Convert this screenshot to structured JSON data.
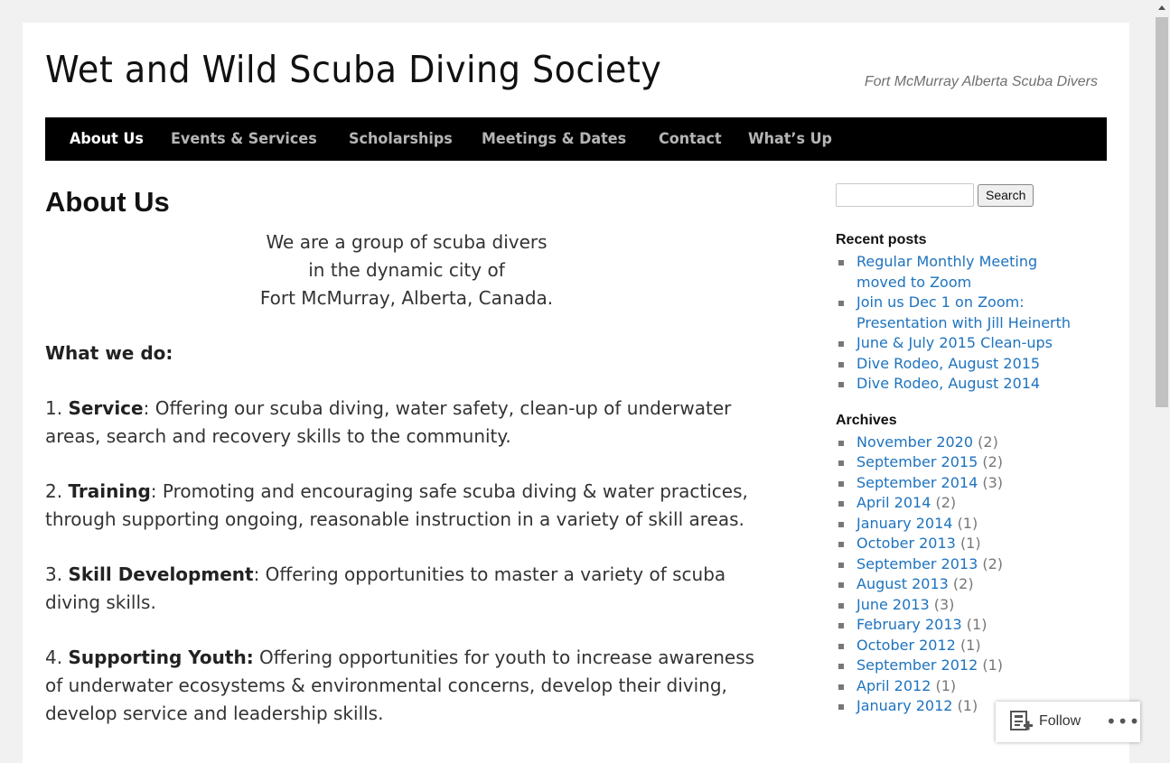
{
  "site": {
    "title": "Wet and Wild Scuba Diving Society",
    "tagline": "Fort McMurray Alberta Scuba Divers"
  },
  "nav": [
    {
      "label": "About Us",
      "active": true
    },
    {
      "label": "Events & Services"
    },
    {
      "label": "Scholarships"
    },
    {
      "label": "Meetings & Dates"
    },
    {
      "label": "Contact"
    },
    {
      "label": "What’s Up"
    }
  ],
  "content": {
    "heading": "About Us",
    "intro": [
      "We are a group of scuba divers",
      "in the dynamic city of",
      "Fort McMurray, Alberta, Canada."
    ],
    "what_we_do": "What we do:",
    "items": [
      {
        "num": "1.",
        "term": "Service",
        "text": ": Offering our scuba diving, water safety, clean-up of underwater areas, search and recovery skills to the community."
      },
      {
        "num": "2.",
        "term": "Training",
        "text": ": Promoting and encouraging safe scuba diving & water practices, through supporting ongoing, reasonable instruction in a variety of skill areas."
      },
      {
        "num": "3.",
        "term": "Skill Development",
        "text": ": Offering opportunities to master a variety of scuba diving skills."
      },
      {
        "num": "4.",
        "term": "Supporting Youth:",
        "text": " Offering opportunities for youth to increase awareness of underwater ecosystems & environmental concerns, develop their diving, develop service and leadership skills."
      }
    ]
  },
  "sidebar": {
    "search_button": "Search",
    "recent_title": "Recent posts",
    "recent_posts": [
      "Regular Monthly Meeting moved to Zoom",
      "Join us Dec 1 on Zoom: Presentation with Jill Heinerth",
      "June & July 2015 Clean-ups",
      "Dive Rodeo, August 2015",
      "Dive Rodeo, August 2014"
    ],
    "archives_title": "Archives",
    "archives": [
      {
        "label": "November 2020",
        "count": "(2)"
      },
      {
        "label": "September 2015",
        "count": "(2)"
      },
      {
        "label": "September 2014",
        "count": "(3)"
      },
      {
        "label": "April 2014",
        "count": "(2)"
      },
      {
        "label": "January 2014",
        "count": "(1)"
      },
      {
        "label": "October 2013",
        "count": "(1)"
      },
      {
        "label": "September 2013",
        "count": "(2)"
      },
      {
        "label": "August 2013",
        "count": "(2)"
      },
      {
        "label": "June 2013",
        "count": "(3)"
      },
      {
        "label": "February 2013",
        "count": "(1)"
      },
      {
        "label": "October 2012",
        "count": "(1)"
      },
      {
        "label": "September 2012",
        "count": "(1)"
      },
      {
        "label": "April 2012",
        "count": "(1)"
      },
      {
        "label": "January 2012",
        "count": "(1)"
      }
    ]
  },
  "follow": {
    "label": "Follow",
    "more": "•••"
  }
}
